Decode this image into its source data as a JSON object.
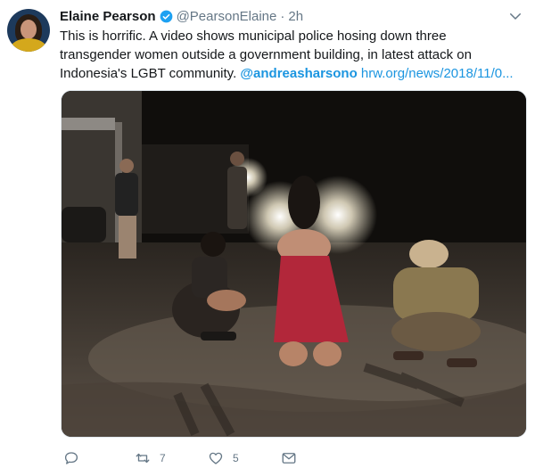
{
  "author": {
    "name": "Elaine Pearson",
    "handle": "@PearsonElaine",
    "separator": "·",
    "time": "2h",
    "verified": true
  },
  "tweet": {
    "text": "This is horrific. A video shows municipal police hosing down three transgender women outside a government building, in latest attack on Indonesia's LGBT community.",
    "mention": "@andreasharsono",
    "link": "hrw.org/news/2018/11/0..."
  },
  "media": {
    "description_icon": "photo"
  },
  "actions": {
    "reply_count": "",
    "retweet_count": "7",
    "like_count": "5"
  },
  "colors": {
    "link": "#1b95e0",
    "secondary_text": "#657786",
    "verified": "#1da1f2"
  }
}
